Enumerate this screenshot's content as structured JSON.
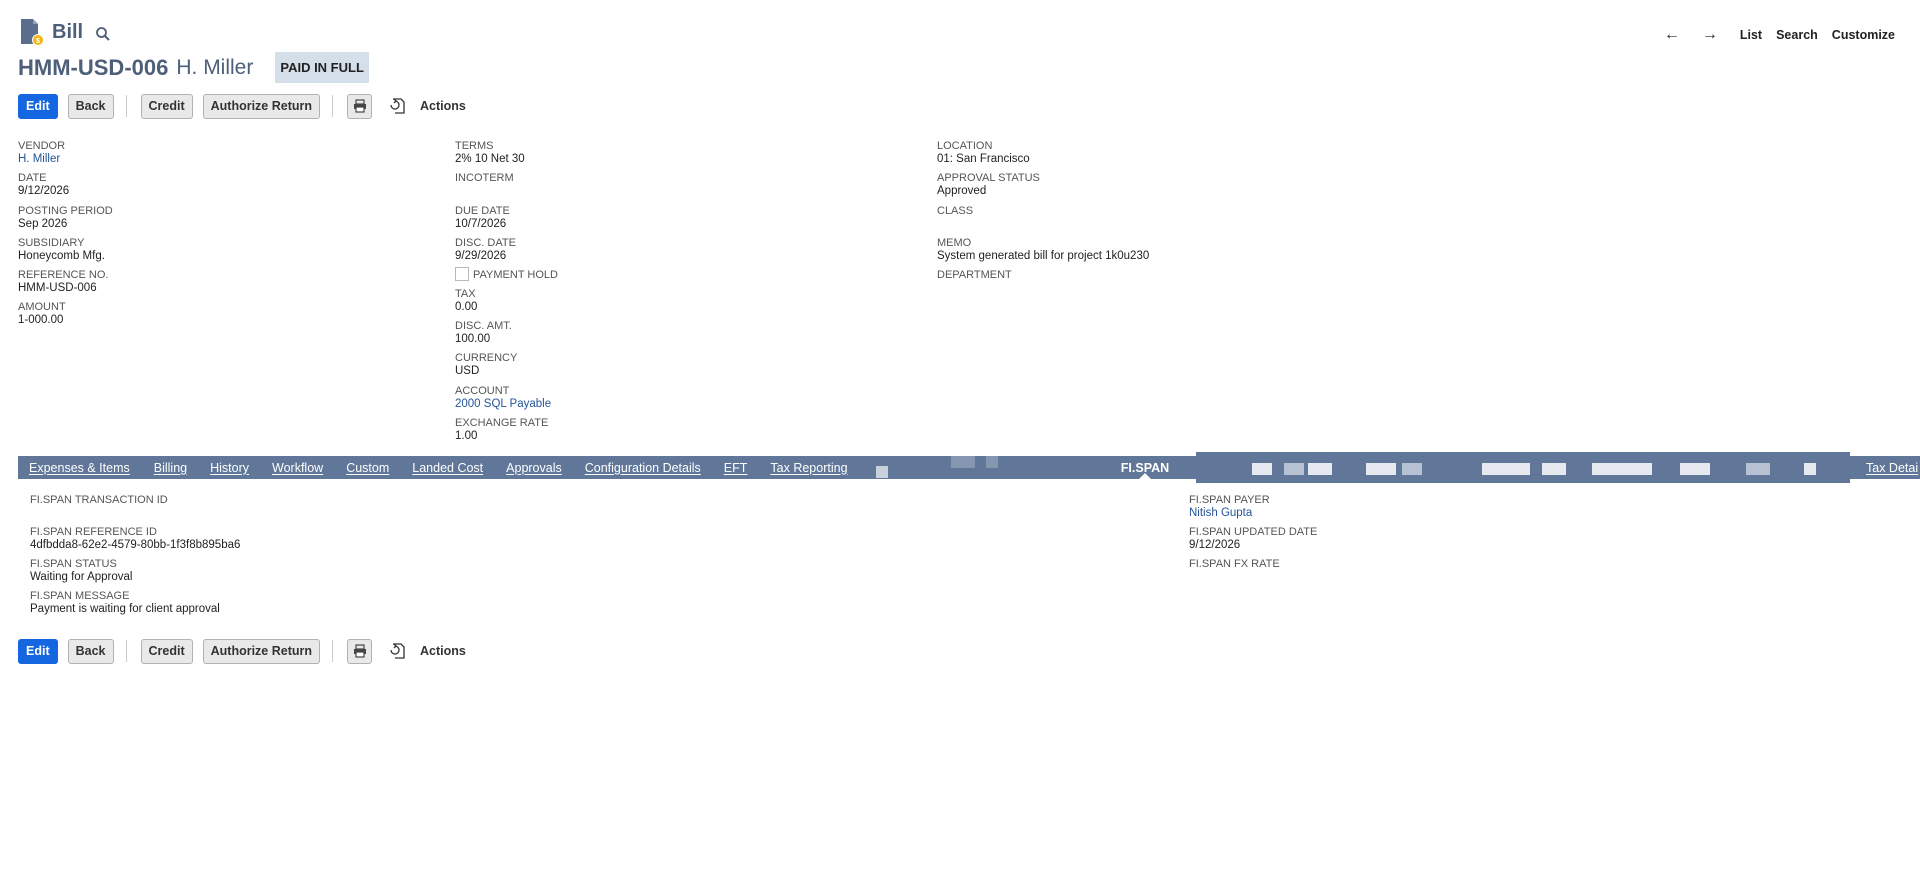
{
  "header": {
    "page_type": "Bill",
    "record_id": "HMM-USD-006",
    "vendor_name": "H. Miller",
    "status": "PAID IN FULL",
    "nav": {
      "prev": "←",
      "next": "→",
      "list": "List",
      "search": "Search",
      "customize": "Customize"
    }
  },
  "toolbar": {
    "edit": "Edit",
    "back": "Back",
    "credit": "Credit",
    "authorize_return": "Authorize Return",
    "actions": "Actions"
  },
  "fields": {
    "vendor": {
      "label": "VENDOR",
      "value": "H. Miller"
    },
    "date": {
      "label": "DATE",
      "value": "9/12/2026"
    },
    "posting_period": {
      "label": "POSTING PERIOD",
      "value": "Sep 2026"
    },
    "subsidiary": {
      "label": "SUBSIDIARY",
      "value": "Honeycomb Mfg."
    },
    "reference_no": {
      "label": "REFERENCE NO.",
      "value": "HMM-USD-006"
    },
    "amount": {
      "label": "AMOUNT",
      "value": "1-000.00"
    },
    "terms": {
      "label": "TERMS",
      "value": "2% 10 Net 30"
    },
    "incoterm": {
      "label": "INCOTERM",
      "value": ""
    },
    "due_date": {
      "label": "DUE DATE",
      "value": "10/7/2026"
    },
    "disc_date": {
      "label": "DISC. DATE",
      "value": "9/29/2026"
    },
    "payment_hold": {
      "label": "PAYMENT HOLD",
      "checked": false
    },
    "tax": {
      "label": "TAX",
      "value": "0.00"
    },
    "disc_amt": {
      "label": "DISC. AMT.",
      "value": "100.00"
    },
    "currency": {
      "label": "CURRENCY",
      "value": "USD"
    },
    "account": {
      "label": "ACCOUNT",
      "value": "2000 SQL Payable"
    },
    "exchange_rate": {
      "label": "EXCHANGE RATE",
      "value": "1.00"
    },
    "location": {
      "label": "LOCATION",
      "value": "01: San Francisco"
    },
    "approval_status": {
      "label": "APPROVAL STATUS",
      "value": "Approved"
    },
    "class": {
      "label": "CLASS",
      "value": ""
    },
    "memo": {
      "label": "MEMO",
      "value": "System generated bill for project 1k0u230"
    },
    "department": {
      "label": "DEPARTMENT",
      "value": ""
    }
  },
  "tabs": {
    "items": [
      "Expenses & Items",
      "Billing",
      "History",
      "Workflow",
      "Custom",
      "Landed Cost",
      "Approvals",
      "Configuration Details",
      "EFT",
      "Tax Reporting"
    ],
    "active": "FI.SPAN",
    "trailing": "Tax Detai"
  },
  "fispan": {
    "transaction_id": {
      "label": "FI.SPAN TRANSACTION ID",
      "value": ""
    },
    "reference_id": {
      "label": "FI.SPAN REFERENCE ID",
      "value": "4dfbdda8-62e2-4579-80bb-1f3f8b895ba6"
    },
    "status": {
      "label": "FI.SPAN STATUS",
      "value": "Waiting for Approval"
    },
    "message": {
      "label": "FI.SPAN MESSAGE",
      "value": "Payment is waiting for client approval"
    },
    "payer": {
      "label": "FI.SPAN PAYER",
      "value": "Nitish Gupta"
    },
    "updated_date": {
      "label": "FI.SPAN UPDATED DATE",
      "value": "9/12/2026"
    },
    "fx_rate": {
      "label": "FI.SPAN FX RATE",
      "value": ""
    }
  },
  "colors": {
    "primary_button": "#1467e0",
    "title": "#4d5f79",
    "tab_bar": "#607799",
    "link": "#255599",
    "status_badge_bg": "#d5dfe9"
  },
  "icons": [
    "bill-icon",
    "search-icon",
    "print-icon",
    "refresh-icon",
    "arrow-left-icon",
    "arrow-right-icon"
  ]
}
